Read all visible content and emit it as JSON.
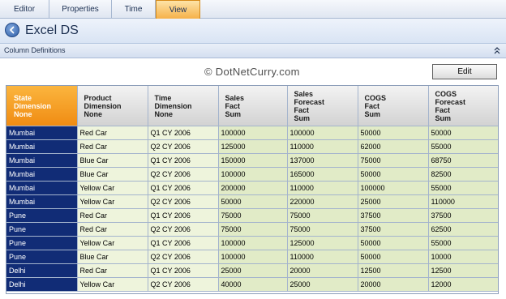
{
  "tabs": [
    {
      "label": "Editor"
    },
    {
      "label": "Properties"
    },
    {
      "label": "Time"
    },
    {
      "label": "View"
    }
  ],
  "header": {
    "title": "Excel DS"
  },
  "section": {
    "title": "Column Definitions"
  },
  "watermark": "© DotNetCurry.com",
  "edit_label": "Edit",
  "grid": {
    "columns": [
      {
        "lines": [
          "State",
          "Dimension",
          "None"
        ]
      },
      {
        "lines": [
          "Product",
          "Dimension",
          "None"
        ]
      },
      {
        "lines": [
          "Time",
          "Dimension",
          "None"
        ]
      },
      {
        "lines": [
          "Sales",
          "Fact",
          "Sum"
        ]
      },
      {
        "lines": [
          "Sales",
          "Forecast",
          "Fact",
          "Sum"
        ]
      },
      {
        "lines": [
          "COGS",
          "Fact",
          "Sum"
        ]
      },
      {
        "lines": [
          "COGS",
          "Forecast",
          "Fact",
          "Sum"
        ]
      }
    ],
    "rows": [
      [
        "Mumbai",
        "Red Car",
        "Q1 CY 2006",
        "100000",
        "100000",
        "50000",
        "50000"
      ],
      [
        "Mumbai",
        "Red Car",
        "Q2 CY 2006",
        "125000",
        "110000",
        "62000",
        "55000"
      ],
      [
        "Mumbai",
        "Blue Car",
        "Q1 CY 2006",
        "150000",
        "137000",
        "75000",
        "68750"
      ],
      [
        "Mumbai",
        "Blue Car",
        "Q2 CY 2006",
        "100000",
        "165000",
        "50000",
        "82500"
      ],
      [
        "Mumbai",
        "Yellow Car",
        "Q1 CY 2006",
        "200000",
        "110000",
        "100000",
        "55000"
      ],
      [
        "Mumbai",
        "Yellow Car",
        "Q2 CY 2006",
        "50000",
        "220000",
        "25000",
        "110000"
      ],
      [
        "Pune",
        "Red Car",
        "Q1 CY 2006",
        "75000",
        "75000",
        "37500",
        "37500"
      ],
      [
        "Pune",
        "Red Car",
        "Q2 CY 2006",
        "75000",
        "75000",
        "37500",
        "62500"
      ],
      [
        "Pune",
        "Yellow Car",
        "Q1 CY 2006",
        "100000",
        "125000",
        "50000",
        "55000"
      ],
      [
        "Pune",
        "Blue Car",
        "Q2 CY 2006",
        "100000",
        "110000",
        "50000",
        "10000"
      ],
      [
        "Delhi",
        "Red Car",
        "Q1 CY 2006",
        "25000",
        "20000",
        "12500",
        "12500"
      ],
      [
        "Delhi",
        "Yellow Car",
        "Q2 CY 2006",
        "40000",
        "25000",
        "20000",
        "12000"
      ]
    ]
  },
  "colors": {
    "tab_active": "#f6b14a",
    "selected_header": "#f08c13",
    "first_column": "#112c76",
    "cell_fill": "#e1ebc7"
  },
  "icons": {
    "back": "back-arrow-icon",
    "collapse": "collapse-up-icon"
  }
}
